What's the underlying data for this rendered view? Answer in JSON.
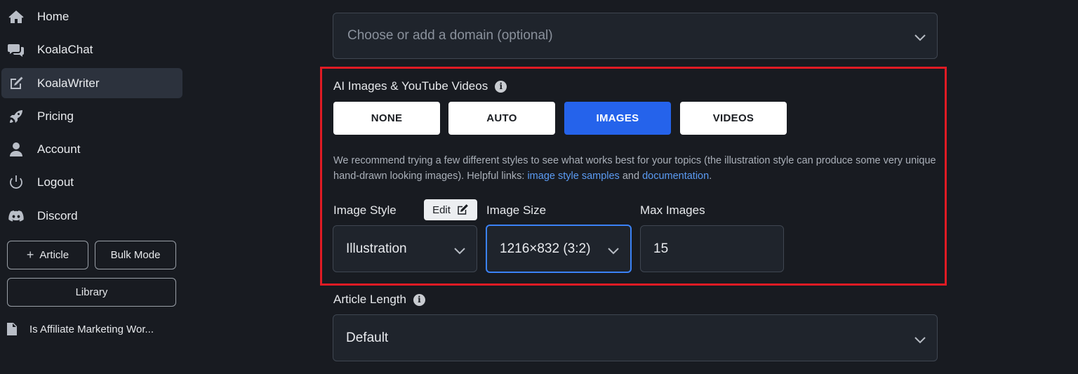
{
  "sidebar": {
    "nav": [
      {
        "label": "Home",
        "icon": "home-icon"
      },
      {
        "label": "KoalaChat",
        "icon": "chat-icon"
      },
      {
        "label": "KoalaWriter",
        "icon": "edit-icon",
        "active": true
      },
      {
        "label": "Pricing",
        "icon": "rocket-icon"
      },
      {
        "label": "Account",
        "icon": "user-icon"
      },
      {
        "label": "Logout",
        "icon": "power-icon"
      },
      {
        "label": "Discord",
        "icon": "discord-icon"
      }
    ],
    "article_button": "Article",
    "bulk_mode_button": "Bulk Mode",
    "library_button": "Library",
    "recent_article": "Is Affiliate Marketing Wor..."
  },
  "main": {
    "domain_select": {
      "placeholder": "Choose or add a domain (optional)"
    },
    "media": {
      "label": "AI Images & YouTube Videos",
      "options": [
        "NONE",
        "AUTO",
        "IMAGES",
        "VIDEOS"
      ],
      "selected": "IMAGES",
      "help_prefix": "We recommend trying a few different styles to see what works best for your topics (the illustration style can produce some very unique hand-drawn looking images). Helpful links: ",
      "help_link1": "image style samples",
      "help_middle": " and ",
      "help_link2": "documentation",
      "help_suffix": ".",
      "image_style_label": "Image Style",
      "edit_label": "Edit",
      "image_style_value": "Illustration",
      "image_size_label": "Image Size",
      "image_size_value": "1216×832 (3:2)",
      "max_images_label": "Max Images",
      "max_images_value": "15"
    },
    "article_length": {
      "label": "Article Length",
      "value": "Default"
    }
  },
  "colors": {
    "background": "#181b21",
    "accent": "#2563eb",
    "highlight": "#e01b24",
    "link": "#5b9bf3"
  }
}
